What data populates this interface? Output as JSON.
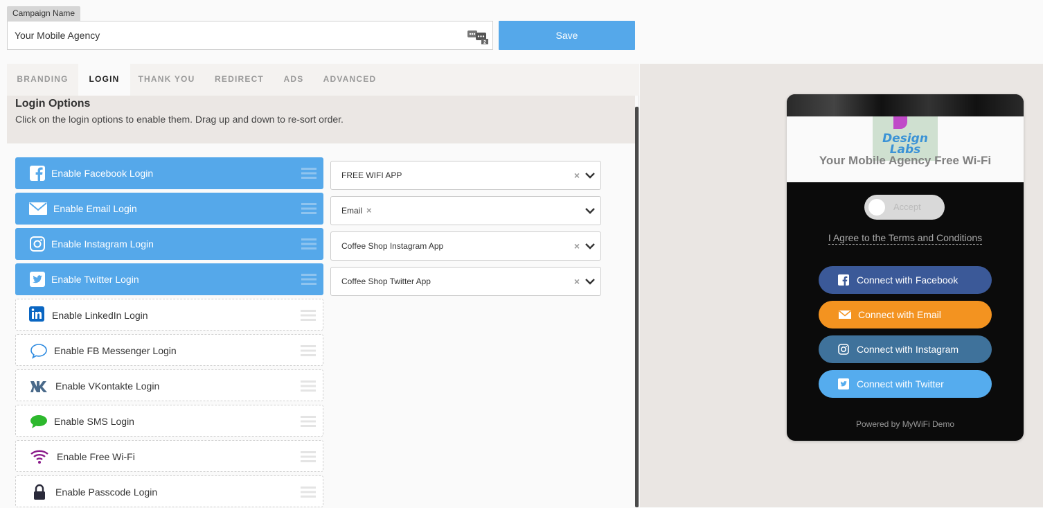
{
  "campaign": {
    "label": "Campaign Name",
    "value": "Your Mobile Agency",
    "badge_count": "2",
    "save_label": "Save"
  },
  "tabs": [
    {
      "label": "BRANDING"
    },
    {
      "label": "LOGIN"
    },
    {
      "label": "THANK YOU"
    },
    {
      "label": "REDIRECT"
    },
    {
      "label": "ADS"
    },
    {
      "label": "ADVANCED"
    }
  ],
  "active_tab": "LOGIN",
  "login_options": {
    "title": "Login Options",
    "description": "Click on the login options to enable them. Drag up and down to re-sort order.",
    "items": [
      {
        "label": "Enable Facebook Login",
        "icon": "facebook-icon",
        "enabled": true
      },
      {
        "label": "Enable Email Login",
        "icon": "envelope-icon",
        "enabled": true
      },
      {
        "label": "Enable Instagram Login",
        "icon": "instagram-icon",
        "enabled": true
      },
      {
        "label": "Enable Twitter Login",
        "icon": "twitter-icon",
        "enabled": true
      },
      {
        "label": "Enable LinkedIn Login",
        "icon": "linkedin-icon",
        "enabled": false
      },
      {
        "label": "Enable FB Messenger Login",
        "icon": "chat-bubble-icon",
        "enabled": false
      },
      {
        "label": "Enable VKontakte Login",
        "icon": "vk-icon",
        "enabled": false
      },
      {
        "label": "Enable SMS Login",
        "icon": "sms-bubble-icon",
        "enabled": false
      },
      {
        "label": "Enable Free Wi-Fi",
        "icon": "wifi-icon",
        "enabled": false
      },
      {
        "label": "Enable Passcode Login",
        "icon": "lock-icon",
        "enabled": false
      }
    ],
    "app_selects": [
      {
        "value": "FREE WIFI APP"
      },
      {
        "value": "Email"
      },
      {
        "value": "Coffee Shop Instagram App"
      },
      {
        "value": "Coffee Shop Twitter App"
      }
    ]
  },
  "preview": {
    "logo_line1": "Design",
    "logo_line2": "Labs",
    "title": "Your Mobile Agency Free Wi-Fi",
    "accept_label": "Accept",
    "agree_text": "I Agree to the Terms and Conditions",
    "buttons": [
      {
        "label": "Connect with Facebook",
        "color": "#3b5998",
        "icon": "facebook-icon"
      },
      {
        "label": "Connect with Email",
        "color": "#f39320",
        "icon": "envelope-icon"
      },
      {
        "label": "Connect with Instagram",
        "color": "#3f729b",
        "icon": "instagram-icon"
      },
      {
        "label": "Connect with Twitter",
        "color": "#55acee",
        "icon": "twitter-icon"
      }
    ],
    "powered": "Powered by MyWiFi Demo"
  },
  "colors": {
    "enabled_option": "#55a8ea",
    "save_button": "#55a8ea"
  }
}
